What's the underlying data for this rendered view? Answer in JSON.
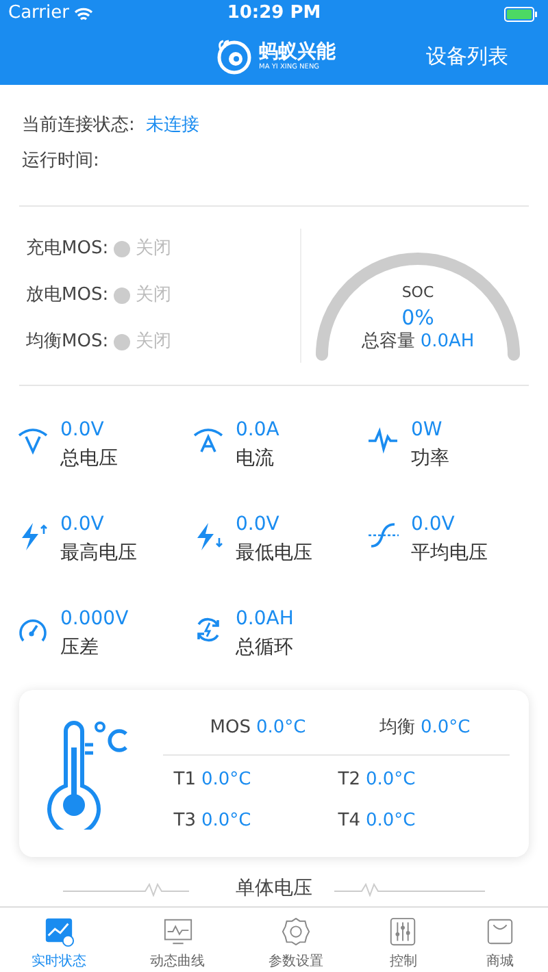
{
  "status_bar": {
    "carrier": "Carrier",
    "time": "10:29 PM"
  },
  "header": {
    "logo_title": "蚂蚁兴能",
    "logo_subtitle": "MA YI XING NENG",
    "right_button": "设备列表"
  },
  "connection": {
    "label": "当前连接状态:",
    "value": "未连接"
  },
  "runtime": {
    "label": "运行时间:"
  },
  "mos": [
    {
      "label": "充电MOS:",
      "state": "关闭",
      "on": false
    },
    {
      "label": "放电MOS:",
      "state": "关闭",
      "on": false
    },
    {
      "label": "均衡MOS:",
      "state": "关闭",
      "on": false
    }
  ],
  "soc": {
    "label": "SOC",
    "value": "0%",
    "capacity_label": "总容量",
    "capacity_value": "0.0AH"
  },
  "metrics": [
    {
      "kind": "voltage",
      "value": "0.0V",
      "label": "总电压"
    },
    {
      "kind": "current",
      "value": "0.0A",
      "label": "电流"
    },
    {
      "kind": "power",
      "value": "0W",
      "label": "功率"
    },
    {
      "kind": "max",
      "value": "0.0V",
      "label": "最高电压"
    },
    {
      "kind": "min",
      "value": "0.0V",
      "label": "最低电压"
    },
    {
      "kind": "average",
      "value": "0.0V",
      "label": "平均电压"
    },
    {
      "kind": "pressure",
      "value": "0.000V",
      "label": "压差"
    },
    {
      "kind": "cycle",
      "value": "0.0AH",
      "label": "总循环"
    }
  ],
  "temperatures": {
    "top": [
      {
        "label": "MOS",
        "value": "0.0°C"
      },
      {
        "label": "均衡",
        "value": "0.0°C"
      }
    ],
    "sensors": [
      {
        "label": "T1",
        "value": "0.0°C"
      },
      {
        "label": "T2",
        "value": "0.0°C"
      },
      {
        "label": "T3",
        "value": "0.0°C"
      },
      {
        "label": "T4",
        "value": "0.0°C"
      }
    ]
  },
  "section_title": "单体电压",
  "tabs": [
    {
      "label": "实时状态",
      "selected": true,
      "kind": "realtime"
    },
    {
      "label": "动态曲线",
      "selected": false,
      "kind": "curve"
    },
    {
      "label": "参数设置",
      "selected": false,
      "kind": "settings"
    },
    {
      "label": "控制",
      "selected": false,
      "kind": "control"
    },
    {
      "label": "商城",
      "selected": false,
      "kind": "shop"
    }
  ]
}
